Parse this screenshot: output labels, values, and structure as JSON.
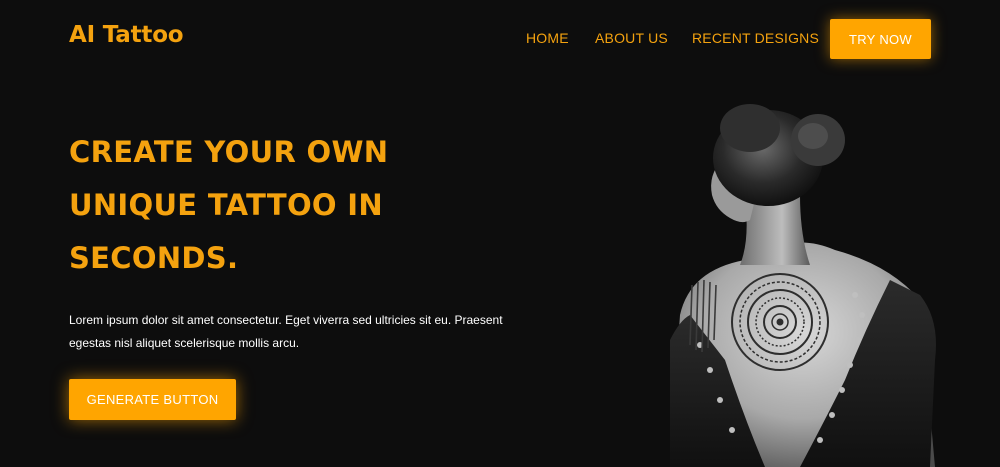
{
  "brand": {
    "name": "AI Tattoo"
  },
  "nav": {
    "home": "HOME",
    "about": "ABOUT US",
    "recent": "RECENT DESIGNS",
    "cta": "TRY NOW"
  },
  "hero": {
    "title_lines": [
      "CREATE YOUR OWN",
      "UNIQUE TATTOO IN",
      "SECONDS."
    ],
    "description_lines": [
      "Lorem ipsum dolor sit amet consectetur. Eget viverra sed ultricies sit eu. Praesent",
      "egestas nisl aliquet scelerisque mollis arcu."
    ],
    "button_label": "GENERATE BUTTON"
  },
  "colors": {
    "background": "#0d0d0d",
    "accent": "#ffa500",
    "accent_text": "#f4a20f"
  }
}
